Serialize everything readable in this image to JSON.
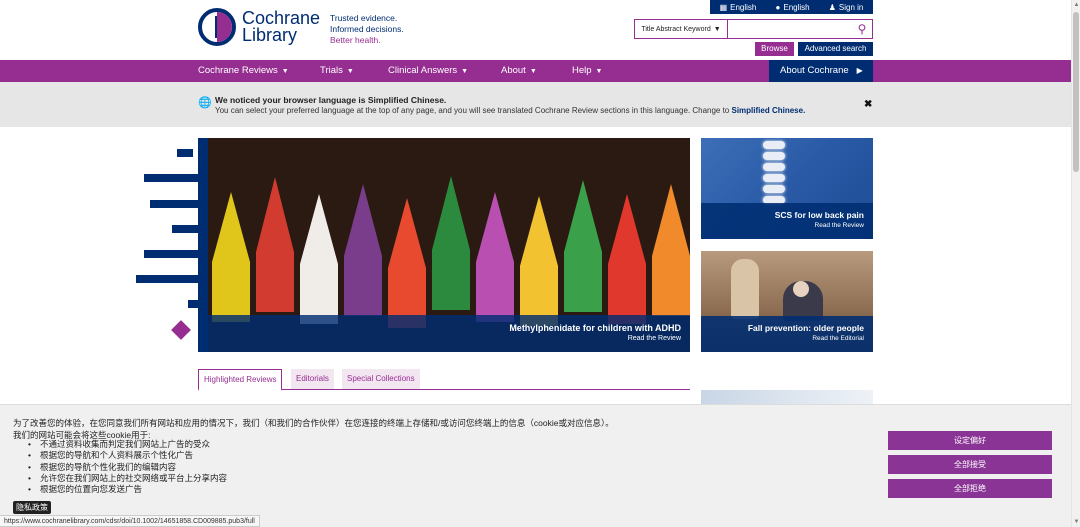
{
  "utility": {
    "lang1": "English",
    "lang2": "English",
    "signin": "Sign in"
  },
  "logo": {
    "line1": "Cochrane",
    "line2": "Library"
  },
  "tagline": {
    "l1": "Trusted evidence.",
    "l2": "Informed decisions.",
    "l3": "Better health."
  },
  "search": {
    "scope": "Title Abstract Keyword",
    "value": ""
  },
  "buttons": {
    "browse": "Browse",
    "advanced": "Advanced search"
  },
  "nav": {
    "items": [
      {
        "label": "Cochrane Reviews"
      },
      {
        "label": "Trials"
      },
      {
        "label": "Clinical Answers"
      },
      {
        "label": "About"
      },
      {
        "label": "Help"
      }
    ],
    "about_cochrane": "About Cochrane"
  },
  "lang_banner": {
    "heading": "We noticed your browser language is Simplified Chinese.",
    "body": "You can select your preferred language at the top of any page, and you will see translated Cochrane Review sections in this language. Change to",
    "link": "Simplified Chinese."
  },
  "hero": {
    "title": "Methylphenidate for children with ADHD",
    "subtitle": "Read the Review"
  },
  "cards": [
    {
      "title": "SCS for low back pain",
      "subtitle": "Read the Review"
    },
    {
      "title": "Fall prevention: older people",
      "subtitle": "Read the Editorial"
    }
  ],
  "tabs": [
    {
      "label": "Highlighted Reviews"
    },
    {
      "label": "Editorials"
    },
    {
      "label": "Special Collections"
    }
  ],
  "cookie": {
    "intro": "为了改善您的体验，在您同意我们所有网站和应用的情况下，我们（和我们的合作伙伴）在您连接的终端上存储和/或访问您终端上的信息（cookie或对应信息）。",
    "intro2": "我们的网站可能会将这些cookie用于:",
    "items": [
      "不通过资料收集而判定我们网站上广告的受众",
      "根据您的导航和个人资料展示个性化广告",
      "根据您的导航个性化我们的编辑内容",
      "允许您在我们网站上的社交网络或平台上分享内容",
      "根据您的位置向您发送广告"
    ],
    "privacy": "隐私政策",
    "btn_prefs": "设定偏好",
    "btn_accept": "全部接受",
    "btn_reject": "全部拒绝"
  },
  "status_url": "https://www.cochranelibrary.com/cdsr/doi/10.1002/14651858.CD009885.pub3/full",
  "colors": {
    "navy": "#002d72",
    "purple": "#962d91"
  }
}
